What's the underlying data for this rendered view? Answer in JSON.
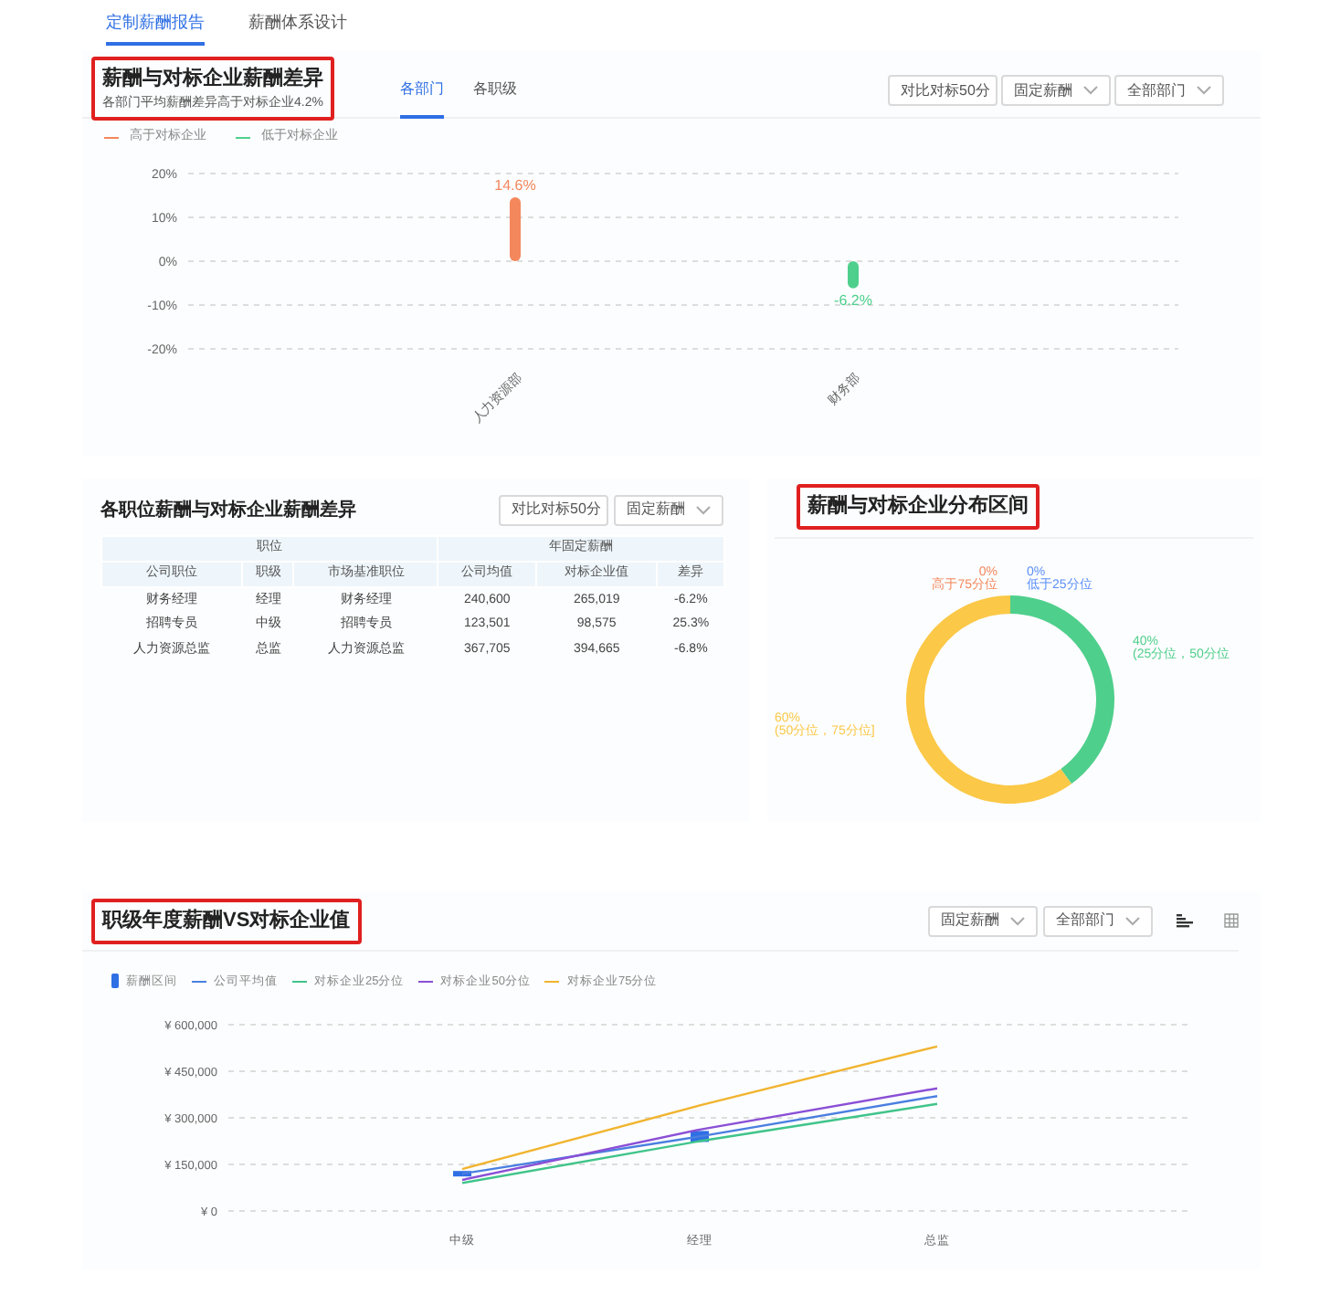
{
  "top_tabs": [
    {
      "label": "定制薪酬报告",
      "selected": true
    },
    {
      "label": "薪酬体系设计",
      "selected": false
    }
  ],
  "dept_diff": {
    "title": "薪酬与对标企业薪酬差异",
    "subtitle": "各部门平均薪酬差异高于对标企业4.2%",
    "tabs": [
      {
        "label": "各部门",
        "selected": true
      },
      {
        "label": "各职级",
        "selected": false
      }
    ],
    "dropdowns": [
      "对比对标50分",
      "固定薪酬",
      "全部部门"
    ],
    "legend": [
      {
        "label": "高于对标企业",
        "color": "#f4875c"
      },
      {
        "label": "低于对标企业",
        "color": "#4fcf8c"
      }
    ],
    "chart_data": {
      "type": "bar",
      "grid": true,
      "categories": [
        "人力资源部",
        "财务部"
      ],
      "values": [
        14.6,
        -6.2
      ],
      "ylim": [
        -20,
        20
      ],
      "yticks": [
        {
          "value": 20,
          "label": "20%"
        },
        {
          "value": 10,
          "label": "10%"
        },
        {
          "value": 0,
          "label": "0%"
        },
        {
          "value": -10,
          "label": "-10%"
        },
        {
          "value": -20,
          "label": "-20%"
        }
      ],
      "value_labels": [
        "14.6%",
        "-6.2%"
      ]
    }
  },
  "position_diff": {
    "title": "各职位薪酬与对标企业薪酬差异",
    "dropdowns": [
      "对比对标50分",
      "固定薪酬"
    ],
    "group_headers": [
      "职位",
      "年固定薪酬"
    ],
    "columns": [
      "公司职位",
      "职级",
      "市场基准职位",
      "公司均值",
      "对标企业值",
      "差异"
    ],
    "rows": [
      [
        "财务经理",
        "经理",
        "财务经理",
        "240,600",
        "265,019",
        "-6.2%"
      ],
      [
        "招聘专员",
        "中级",
        "招聘专员",
        "123,501",
        "98,575",
        "25.3%"
      ],
      [
        "人力资源总监",
        "总监",
        "人力资源总监",
        "367,705",
        "394,665",
        "-6.8%"
      ]
    ]
  },
  "distribution": {
    "title": "薪酬与对标企业分布区间",
    "chart_data": {
      "type": "donut",
      "categories": [
        "低于25分位",
        "(25分位，50分位",
        "(50分位，75分位]",
        "高于75分位"
      ],
      "values": [
        0,
        40,
        60,
        0
      ],
      "colors": [
        "#5b8ff9",
        "#4fcf8c",
        "#fbc847",
        "#f4875c"
      ],
      "value_labels": [
        "0%",
        "40%",
        "60%",
        "0%"
      ]
    }
  },
  "level_vs": {
    "title": "职级年度薪酬VS对标企业值",
    "dropdowns": [
      "固定薪酬",
      "全部部门"
    ],
    "salary_ranges": [
      {
        "kind": "range",
        "label": "薪酬区间",
        "color": "#2f6fe4",
        "shown": [
          true,
          true,
          false
        ]
      }
    ],
    "chart_data": {
      "type": "line",
      "grid": true,
      "categories": [
        "中级",
        "经理",
        "总监"
      ],
      "ylim": [
        0,
        600000
      ],
      "yticks": [
        {
          "value": 0,
          "label": "¥ 0"
        },
        {
          "value": 150000,
          "label": "¥ 150,000"
        },
        {
          "value": 300000,
          "label": "¥ 300,000"
        },
        {
          "value": 450000,
          "label": "¥ 450,000"
        },
        {
          "value": 600000,
          "label": "¥ 600,000"
        }
      ],
      "series": [
        {
          "name": "公司平均值",
          "color": "#4a7fe0",
          "values": [
            120000,
            240000,
            370000
          ]
        },
        {
          "name": "对标企业25分位",
          "color": "#3fc48a",
          "values": [
            90000,
            225000,
            345000
          ]
        },
        {
          "name": "对标企业50分位",
          "color": "#8a4fd6",
          "values": [
            100000,
            262000,
            395000
          ]
        },
        {
          "name": "对标企业75分位",
          "color": "#f1b42f",
          "values": [
            135000,
            340000,
            530000
          ]
        }
      ]
    }
  }
}
